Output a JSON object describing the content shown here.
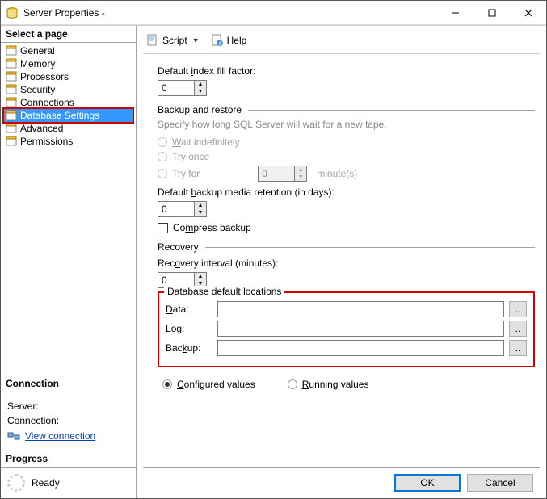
{
  "window": {
    "title": "Server Properties -"
  },
  "sidebar": {
    "select_page": "Select a page",
    "items": [
      {
        "label": "General"
      },
      {
        "label": "Memory"
      },
      {
        "label": "Processors"
      },
      {
        "label": "Security"
      },
      {
        "label": "Connections"
      },
      {
        "label": "Database Settings",
        "selected": true
      },
      {
        "label": "Advanced"
      },
      {
        "label": "Permissions"
      }
    ],
    "connection_head": "Connection",
    "server_label": "Server:",
    "connection_label": "Connection:",
    "view_connection": "View connection ",
    "progress_head": "Progress",
    "progress_status": "Ready"
  },
  "toolbar": {
    "script": "Script",
    "help": "Help"
  },
  "form": {
    "fill_factor_label": "Default index fill factor:",
    "fill_factor_value": "0",
    "backup_restore_title": "Backup and restore",
    "backup_hint": "Specify how long SQL Server will wait for a new tape.",
    "wait_indef": "Wait indefinitely",
    "try_once": "Try once",
    "try_for": "Try for",
    "try_for_value": "0",
    "minutes": "minute(s)",
    "retention_label": "Default backup media retention (in days):",
    "retention_value": "0",
    "compress_label": "Compress backup",
    "recovery_title": "Recovery",
    "recovery_interval_label": "Recovery interval (minutes):",
    "recovery_interval_value": "0",
    "locations_title": "Database default locations",
    "data_label": "Data:",
    "log_label": "Log:",
    "backup_label": "Backup:",
    "data_value": "",
    "log_value": "",
    "backup_value": "",
    "browse": "..",
    "configured": "Configured values",
    "running": "Running values"
  },
  "footer": {
    "ok": "OK",
    "cancel": "Cancel"
  }
}
